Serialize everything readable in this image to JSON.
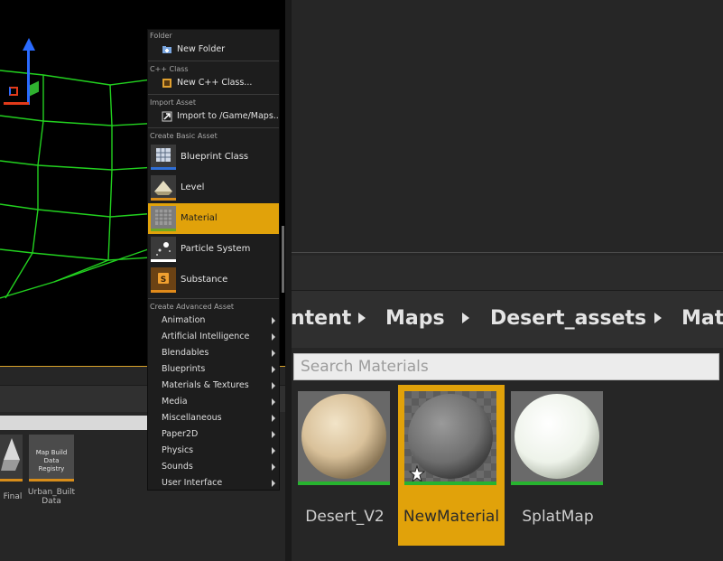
{
  "context_menu": {
    "sections": {
      "folder": "Folder",
      "cpp": "C++ Class",
      "import": "Import Asset",
      "basic": "Create Basic Asset",
      "advanced": "Create Advanced Asset"
    },
    "items": {
      "new_folder": "New Folder",
      "new_cpp_class": "New C++ Class...",
      "import": "Import to /Game/Maps..."
    },
    "basic_assets": [
      {
        "label": "Blueprint Class",
        "bar_color": "#2f6fd6"
      },
      {
        "label": "Level",
        "bar_color": "#d88d1a"
      },
      {
        "label": "Material",
        "bar_color": "#6fa820",
        "highlighted": true
      },
      {
        "label": "Particle System",
        "bar_color": "#ffffff"
      },
      {
        "label": "Substance",
        "bar_color": "#e08a1a"
      }
    ],
    "advanced_assets": [
      "Animation",
      "Artificial Intelligence",
      "Blendables",
      "Blueprints",
      "Materials & Textures",
      "Media",
      "Miscellaneous",
      "Paper2D",
      "Physics",
      "Sounds",
      "User Interface"
    ],
    "highlight_color": "#e1a20a"
  },
  "left_panel": {
    "thumb_label": "Map Build Data Registry",
    "caption_final": "Final",
    "caption_urban": "Urban_Built Data"
  },
  "content_browser": {
    "breadcrumb": [
      "ntent",
      "Maps",
      "Desert_assets",
      "Mat"
    ],
    "search_placeholder": "Search Materials",
    "assets": [
      {
        "name": "Desert_V2",
        "selected": false
      },
      {
        "name": "NewMaterial",
        "selected": true
      },
      {
        "name": "SplatMap",
        "selected": false
      }
    ],
    "selection_color": "#e1a20a",
    "material_bar_color": "#27b32f"
  }
}
